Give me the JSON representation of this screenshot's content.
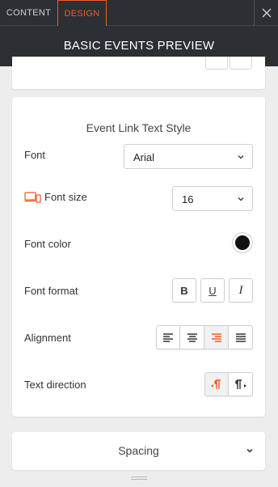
{
  "tabs": [
    {
      "label": "CONTENT",
      "active": false
    },
    {
      "label": "DESIGN",
      "active": true
    }
  ],
  "header": {
    "title": "BASIC EVENTS PREVIEW"
  },
  "colors": {
    "accent": "#f15a29",
    "header_bg": "#2c2f33",
    "font_color_value": "#111111"
  },
  "section": {
    "title": "Event Link Text Style",
    "font": {
      "label": "Font",
      "value": "Arial"
    },
    "font_size": {
      "label": "Font size",
      "value": "16",
      "icon": "devices-icon"
    },
    "font_color": {
      "label": "Font color"
    },
    "font_format": {
      "label": "Font format",
      "buttons": [
        "B",
        "U",
        "I"
      ]
    },
    "alignment": {
      "label": "Alignment",
      "options": [
        "align-left",
        "align-center",
        "align-right",
        "justify"
      ],
      "selected": "align-right"
    },
    "text_direction": {
      "label": "Text direction",
      "options": [
        "ltr",
        "rtl"
      ],
      "selected": "ltr"
    }
  },
  "spacing": {
    "label": "Spacing"
  }
}
